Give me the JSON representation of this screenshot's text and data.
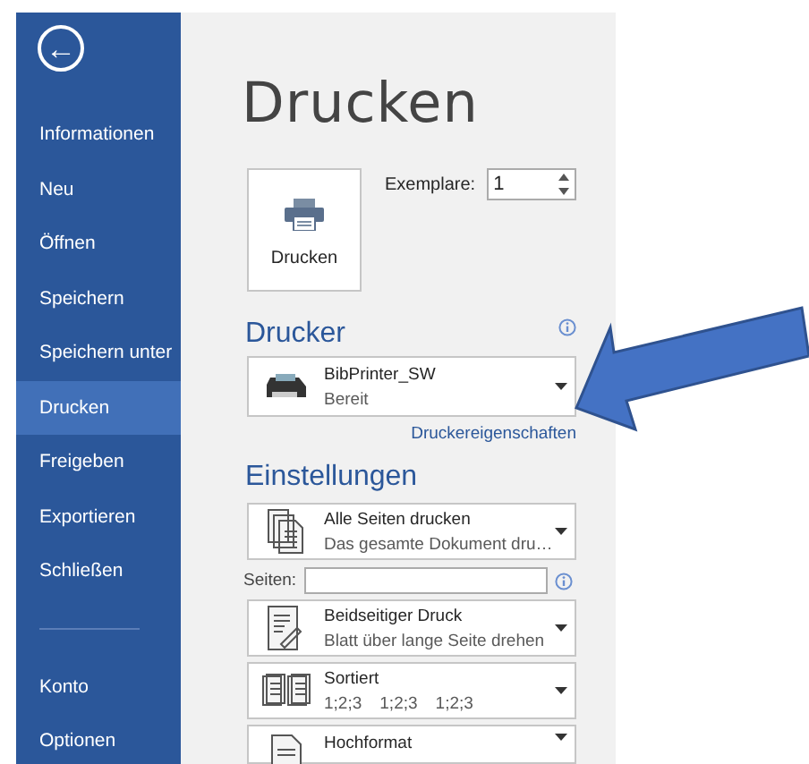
{
  "sidebar": {
    "back_button": {
      "label": "←"
    },
    "items": [
      {
        "label": "Informationen",
        "selected": false
      },
      {
        "label": "Neu",
        "selected": false
      },
      {
        "label": "Öffnen",
        "selected": false
      },
      {
        "label": "Speichern",
        "selected": false
      },
      {
        "label": "Speichern unter",
        "selected": false
      },
      {
        "label": "Drucken",
        "selected": true
      },
      {
        "label": "Freigeben",
        "selected": false
      },
      {
        "label": "Exportieren",
        "selected": false
      },
      {
        "label": "Schließen",
        "selected": false
      }
    ],
    "footer_items": [
      {
        "label": "Konto",
        "selected": false
      },
      {
        "label": "Optionen",
        "selected": false
      }
    ]
  },
  "print": {
    "title": "Drucken",
    "print_button": {
      "label": "Drucken"
    },
    "copies": {
      "label": "Exemplare:",
      "value": "1"
    },
    "printer_section": {
      "heading": "Drucker",
      "printer": {
        "name": "BibPrinter_SW",
        "status": "Bereit"
      },
      "properties_link": "Druckereigenschaften"
    },
    "settings_section": {
      "heading": "Einstellungen",
      "settings": [
        {
          "kind": "pages",
          "title": "Alle Seiten drucken",
          "subtitle": "Das gesamte Dokument dru…"
        },
        {
          "kind": "field",
          "label": "Seiten:"
        },
        {
          "kind": "duplex",
          "title": "Beidseitiger Druck",
          "subtitle": "Blatt über lange Seite drehen"
        },
        {
          "kind": "collate",
          "title": "Sortiert",
          "sequences": [
            "1;2;3",
            "1;2;3",
            "1;2;3"
          ]
        },
        {
          "kind": "orientation",
          "title": "Hochformat"
        }
      ]
    }
  },
  "callout": {
    "kind": "arrow"
  }
}
